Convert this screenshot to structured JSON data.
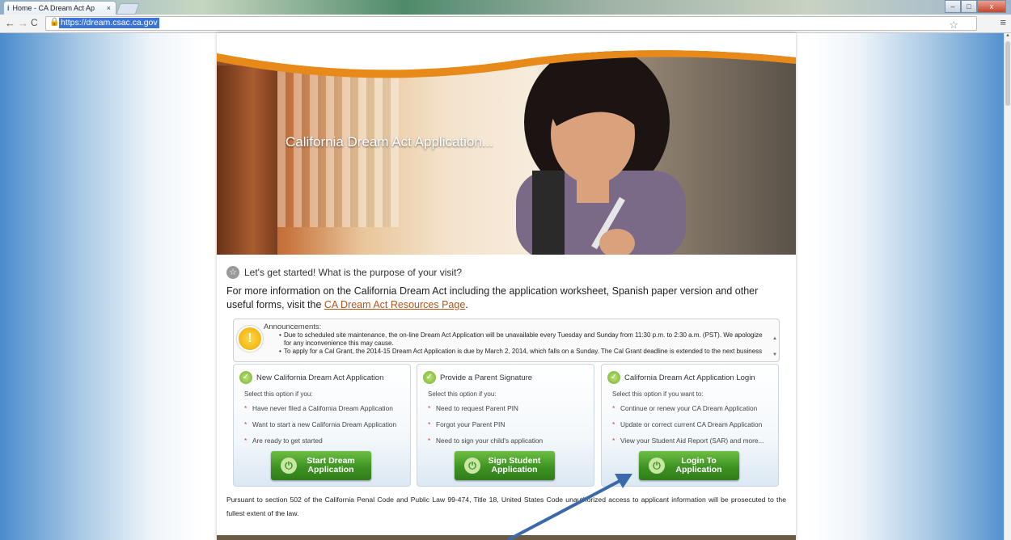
{
  "browser": {
    "tab_title": "Home - CA Dream Act Ap",
    "tab_close": "×",
    "url": "https://dream.csac.ca.gov",
    "window_buttons": {
      "minimize": "–",
      "maximize": "□",
      "close": "x"
    }
  },
  "hero": {
    "title": "California Dream Act Application..."
  },
  "intro": {
    "heading": "Let's get started! What is the purpose of your visit?"
  },
  "info": {
    "text": "For more information on the California Dream Act including the application worksheet, Spanish paper version and other useful forms, visit the",
    "link_text": "CA Dream Act Resources Page",
    "after_link": "."
  },
  "announcements": {
    "title": "Announcements:",
    "items": [
      "Due to scheduled site maintenance, the on-line Dream Act Application will be unavailable every Tuesday and Sunday from 11:30 p.m. to 2:30 a.m. (PST). We apologize for any inconvenience this may cause.",
      "To apply for a Cal Grant, the 2014-15 Dream Act Application is due by March 2, 2014, which falls on a Sunday. The Cal Grant deadline is extended to the next business"
    ]
  },
  "cards": [
    {
      "title": "New California Dream Act Application",
      "subtitle": "Select this option if you:",
      "items": [
        "Have never filed a California Dream Application",
        "Want to start a new California Dream Application",
        "Are ready to get started"
      ],
      "button": "Start Dream\nApplication"
    },
    {
      "title": "Provide a Parent Signature",
      "subtitle": "Select this option if you:",
      "items": [
        "Need to request Parent PIN",
        "Forgot your Parent PIN",
        "Need to sign your child's application"
      ],
      "button": "Sign Student\nApplication"
    },
    {
      "title": "California Dream Act Application Login",
      "subtitle": "Select this option if you want to:",
      "items": [
        "Continue or renew your CA Dream Application",
        "Update or correct current CA Dream Application",
        "View your Student Aid Report (SAR) and more..."
      ],
      "button": "Login To\nApplication"
    }
  ],
  "legal": "Pursuant to section 502 of the California Penal Code and Public Law 99-474, Title 18, United States Code unauthorized access to applicant information will be prosecuted to the fullest extent of the law.",
  "colors": {
    "accent_orange": "#e88a1a",
    "button_green": "#3e9323",
    "link": "#b0541c",
    "arrow": "#3b6aa8"
  }
}
